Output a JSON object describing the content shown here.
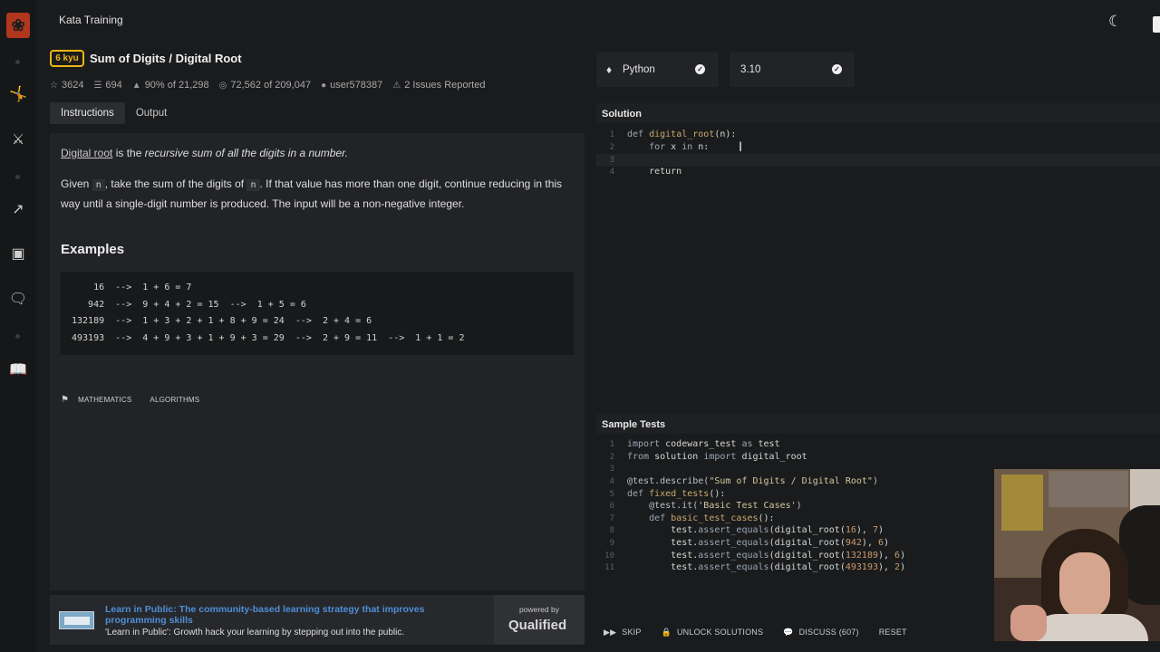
{
  "app": {
    "section_title": "Kata Training"
  },
  "kata": {
    "rank": "6 kyu",
    "title": "Sum of Digits / Digital Root",
    "stats": {
      "stars": "3624",
      "collections": "694",
      "satisfaction": "90% of 21,298",
      "completions": "72,562 of 209,047",
      "author": "user578387",
      "issues": "2 Issues Reported"
    }
  },
  "tabs": {
    "instructions": "Instructions",
    "output": "Output"
  },
  "instructions": {
    "intro_link": "Digital root",
    "intro_mid": " is the ",
    "intro_em": "recursive sum of all the digits in a number.",
    "p2_a": "Given ",
    "p2_code": "n",
    "p2_b": ", take the sum of the digits of ",
    "p2_code2": "n",
    "p2_c": ". If that value has more than one digit, continue reducing in this way until a single-digit number is produced. The input will be a non-negative integer.",
    "examples_title": "Examples",
    "examples": [
      "    16  -->  1 + 6 = 7",
      "   942  -->  9 + 4 + 2 = 15  -->  1 + 5 = 6",
      "132189  -->  1 + 3 + 2 + 1 + 8 + 9 = 24  -->  2 + 4 = 6",
      "493193  -->  4 + 9 + 3 + 1 + 9 + 3 = 29  -->  2 + 9 = 11  -->  1 + 1 = 2"
    ],
    "tags": [
      "Mathematics",
      "Algorithms"
    ]
  },
  "ad": {
    "headline": "Learn in Public: The community-based learning strategy that improves programming skills",
    "subline": "'Learn in Public': Growth hack your learning by stepping out into the public.",
    "powered_by": "powered by",
    "brand": "Qualified"
  },
  "language_select": {
    "value": "Python",
    "icon": "python-icon"
  },
  "version_select": {
    "value": "3.10"
  },
  "solution": {
    "header": "Solution",
    "lines": [
      {
        "n": "1",
        "code": "def digital_root(n):"
      },
      {
        "n": "2",
        "code": "    for x in n:"
      },
      {
        "n": "3",
        "code": ""
      },
      {
        "n": "4",
        "code": "    return"
      }
    ]
  },
  "sample_tests": {
    "header": "Sample Tests",
    "lines": [
      {
        "n": "1",
        "code": "import codewars_test as test"
      },
      {
        "n": "2",
        "code": "from solution import digital_root"
      },
      {
        "n": "3",
        "code": ""
      },
      {
        "n": "4",
        "code": "@test.describe(\"Sum of Digits / Digital Root\")"
      },
      {
        "n": "5",
        "code": "def fixed_tests():"
      },
      {
        "n": "6",
        "code": "    @test.it('Basic Test Cases')"
      },
      {
        "n": "7",
        "code": "    def basic_test_cases():"
      },
      {
        "n": "8",
        "code": "        test.assert_equals(digital_root(16), 7)"
      },
      {
        "n": "9",
        "code": "        test.assert_equals(digital_root(942), 6)"
      },
      {
        "n": "10",
        "code": "        test.assert_equals(digital_root(132189), 6)"
      },
      {
        "n": "11",
        "code": "        test.assert_equals(digital_root(493193), 2)"
      }
    ]
  },
  "actions": {
    "skip": "Skip",
    "unlock": "Unlock Solutions",
    "discuss": "Discuss (607)",
    "reset": "Reset"
  }
}
